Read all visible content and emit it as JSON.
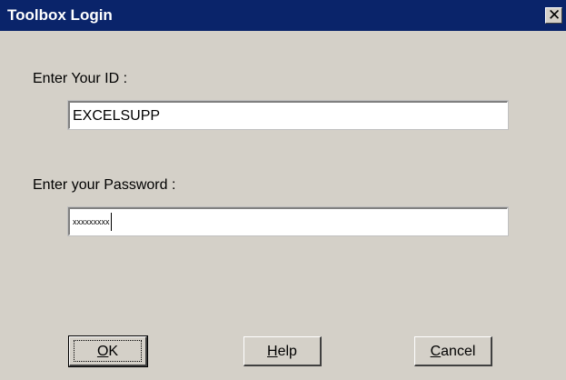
{
  "window": {
    "title": "Toolbox Login",
    "close_glyph": "✕"
  },
  "form": {
    "id_label": "Enter Your ID :",
    "id_value": "EXCELSUPP",
    "password_label": "Enter your Password :",
    "password_mask": "xxxxxxxxx"
  },
  "buttons": {
    "ok_label": "OK",
    "help_label": "Help",
    "cancel_label": "Cancel"
  },
  "colors": {
    "titlebar": "#0a246a",
    "dialog_background": "#d4d0c8"
  }
}
